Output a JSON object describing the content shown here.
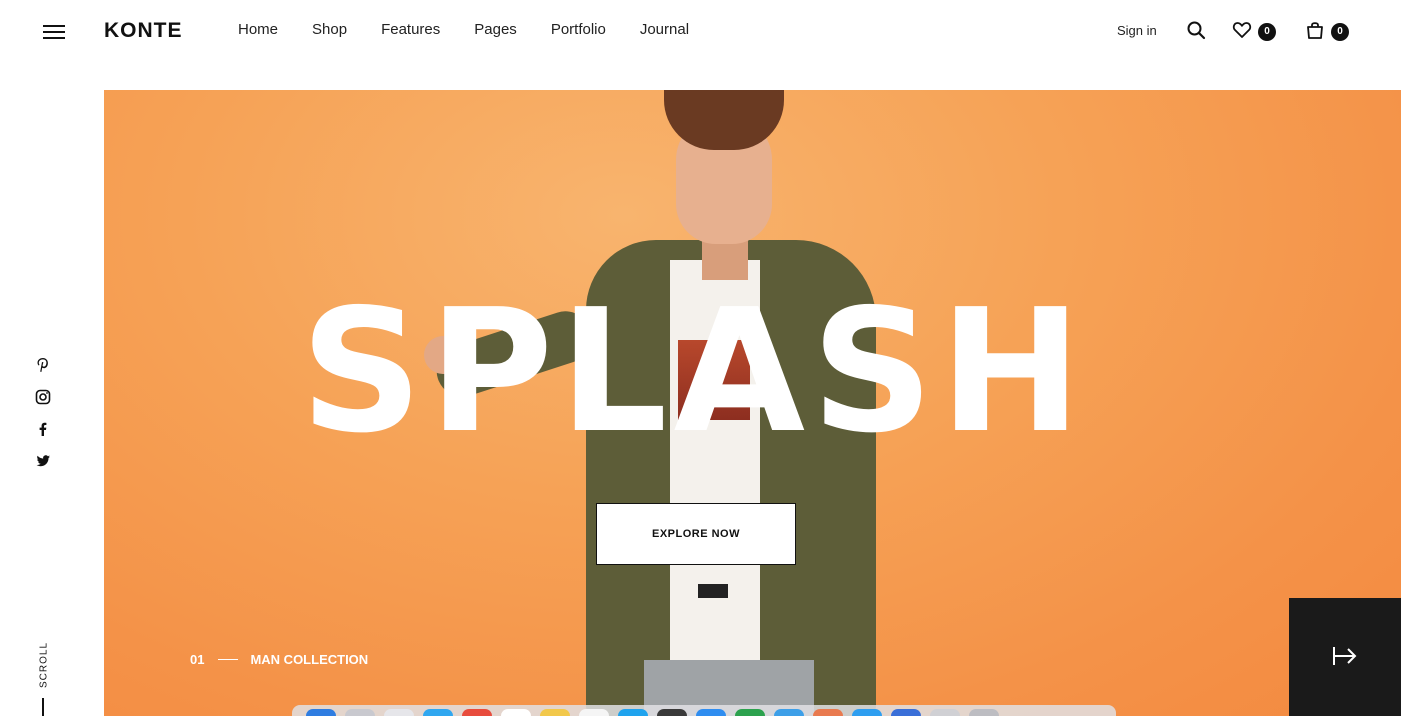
{
  "header": {
    "logo": "KONTE",
    "nav": [
      "Home",
      "Shop",
      "Features",
      "Pages",
      "Portfolio",
      "Journal"
    ],
    "sign_in": "Sign in",
    "wishlist_count": "0",
    "cart_count": "0"
  },
  "sidebar": {
    "social": [
      "pinterest-icon",
      "instagram-icon",
      "facebook-icon",
      "twitter-icon"
    ],
    "scroll_label": "SCROLL"
  },
  "hero": {
    "title": "SPLASH",
    "button_label": "EXPLORE NOW",
    "slide_number": "01",
    "slide_caption": "MAN COLLECTION",
    "background_color": "#f6a256",
    "next_icon": "arrow-right-icon"
  },
  "dock": {
    "apps": [
      "#2f7de1",
      "#c9c9cf",
      "#e6e6ea",
      "#30a7f0",
      "#e84c3d",
      "#ffffff",
      "#f2c84b",
      "#f5f5f5",
      "#1fa3ee",
      "#3a3a3a",
      "#2f8df0",
      "#2ca24e",
      "#3d9fe8",
      "#e97a4f",
      "#2e9ef0",
      "#3a6fd8",
      "#d0d0d4",
      "#bdbdc2"
    ]
  }
}
